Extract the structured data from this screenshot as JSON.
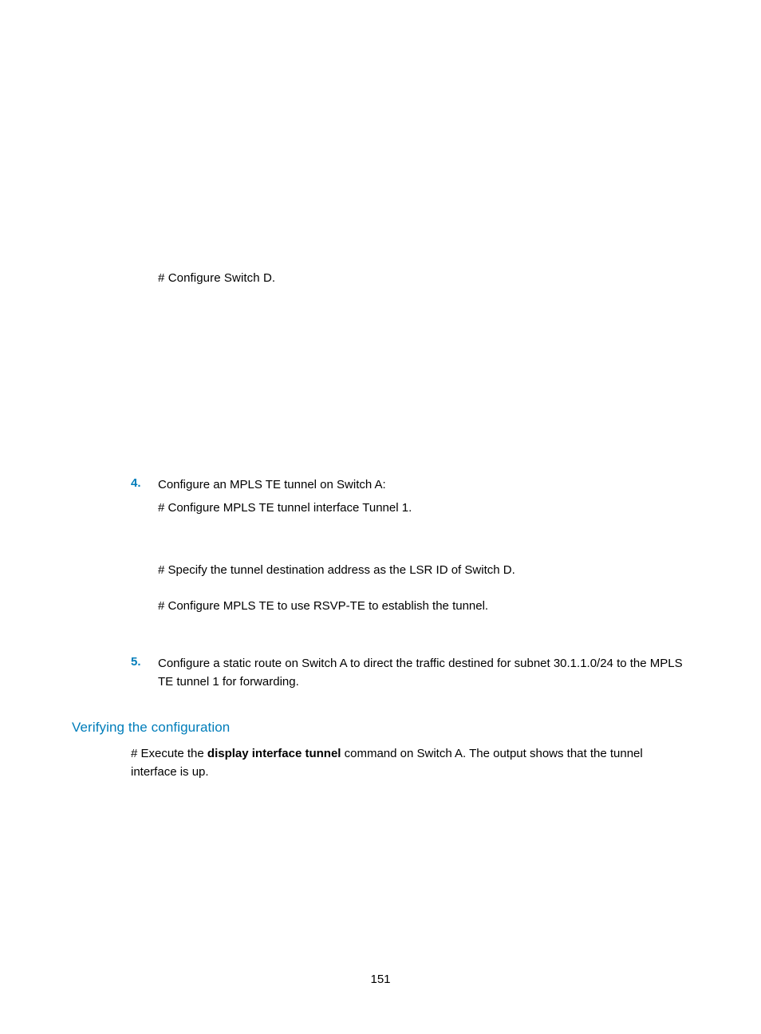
{
  "intro": {
    "line1": "# Configure Switch D."
  },
  "step4": {
    "num": "4.",
    "title": "Configure an MPLS TE tunnel on Switch A:",
    "l1": "# Configure MPLS TE tunnel interface Tunnel 1.",
    "l2": "# Specify the tunnel destination address as the LSR ID of Switch D.",
    "l3": "# Configure MPLS TE to use RSVP-TE to establish the tunnel."
  },
  "step5": {
    "num": "5.",
    "text": "Configure a static route on Switch A to direct the traffic destined for subnet 30.1.1.0/24 to the MPLS TE tunnel 1 for forwarding."
  },
  "verify": {
    "heading": "Verifying the configuration",
    "body_pre": "# Execute the ",
    "body_bold": "display interface tunnel",
    "body_post": " command on Switch A. The output shows that the tunnel interface is up."
  },
  "pageNumber": "151"
}
